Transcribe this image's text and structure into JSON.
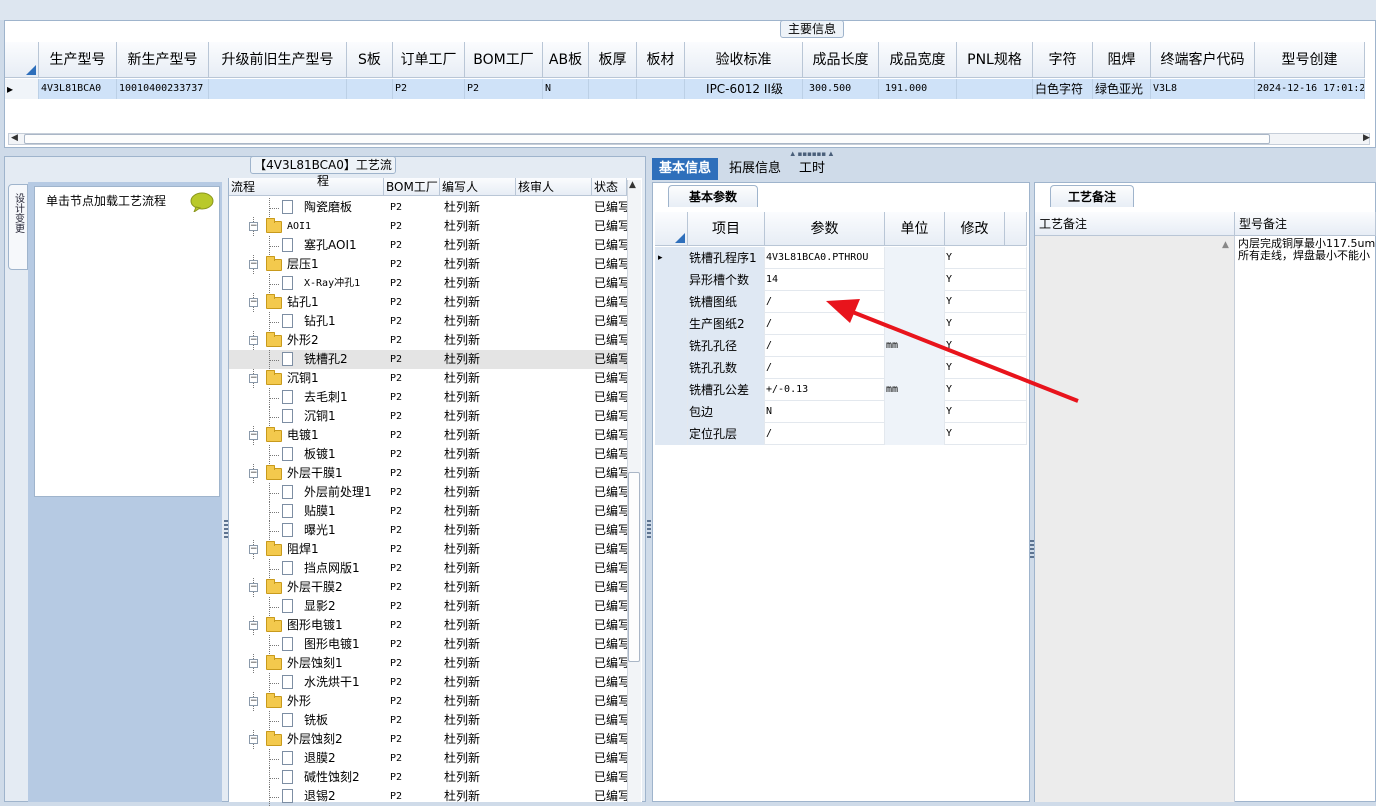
{
  "main_info": {
    "title": "主要信息",
    "columns": [
      "生产型号",
      "新生产型号",
      "升级前旧生产型号",
      "S板",
      "订单工厂",
      "BOM工厂",
      "AB板",
      "板厚",
      "板材",
      "验收标准",
      "成品长度",
      "成品宽度",
      "PNL规格",
      "字符",
      "阻焊",
      "终端客户代码",
      "型号创建"
    ],
    "row": [
      "4V3L81BCA0",
      "10010400233737",
      "",
      "",
      "P2",
      "P2",
      "N",
      "",
      "",
      "IPC-6012 II级",
      "300.500",
      "191.000",
      "",
      "白色字符",
      "绿色亚光",
      "V3L8",
      "2024-12-16 17:01:2"
    ]
  },
  "flow_panel": {
    "title": "【4V3L81BCA0】工艺流程",
    "side_tab": "设计变更",
    "nav_hint": "单击节点加载工艺流程",
    "columns": [
      "流程",
      "BOM工厂",
      "编写人",
      "核审人",
      "状态"
    ],
    "rows": [
      {
        "name": "陶瓷磨板",
        "level": 2,
        "bom": "P2",
        "writer": "杜列新",
        "status": "已编写"
      },
      {
        "name": "AOI1",
        "level": 1,
        "bom": "P2",
        "writer": "杜列新",
        "status": "已编写"
      },
      {
        "name": "塞孔AOI1",
        "level": 2,
        "bom": "P2",
        "writer": "杜列新",
        "status": "已编写"
      },
      {
        "name": "层压1",
        "level": 1,
        "bom": "P2",
        "writer": "杜列新",
        "status": "已编写"
      },
      {
        "name": "X-Ray冲孔1",
        "level": 2,
        "bom": "P2",
        "writer": "杜列新",
        "status": "已编写"
      },
      {
        "name": "钻孔1",
        "level": 1,
        "bom": "P2",
        "writer": "杜列新",
        "status": "已编写"
      },
      {
        "name": "钻孔1",
        "level": 2,
        "bom": "P2",
        "writer": "杜列新",
        "status": "已编写"
      },
      {
        "name": "外形2",
        "level": 1,
        "bom": "P2",
        "writer": "杜列新",
        "status": "已编写"
      },
      {
        "name": "铣槽孔2",
        "level": 2,
        "bom": "P2",
        "writer": "杜列新",
        "status": "已编写",
        "selected": true
      },
      {
        "name": "沉铜1",
        "level": 1,
        "bom": "P2",
        "writer": "杜列新",
        "status": "已编写"
      },
      {
        "name": "去毛刺1",
        "level": 2,
        "bom": "P2",
        "writer": "杜列新",
        "status": "已编写"
      },
      {
        "name": "沉铜1",
        "level": 2,
        "bom": "P2",
        "writer": "杜列新",
        "status": "已编写"
      },
      {
        "name": "电镀1",
        "level": 1,
        "bom": "P2",
        "writer": "杜列新",
        "status": "已编写"
      },
      {
        "name": "板镀1",
        "level": 2,
        "bom": "P2",
        "writer": "杜列新",
        "status": "已编写"
      },
      {
        "name": "外层干膜1",
        "level": 1,
        "bom": "P2",
        "writer": "杜列新",
        "status": "已编写"
      },
      {
        "name": "外层前处理1",
        "level": 2,
        "bom": "P2",
        "writer": "杜列新",
        "status": "已编写"
      },
      {
        "name": "贴膜1",
        "level": 2,
        "bom": "P2",
        "writer": "杜列新",
        "status": "已编写"
      },
      {
        "name": "曝光1",
        "level": 2,
        "bom": "P2",
        "writer": "杜列新",
        "status": "已编写"
      },
      {
        "name": "阻焊1",
        "level": 1,
        "bom": "P2",
        "writer": "杜列新",
        "status": "已编写"
      },
      {
        "name": "挡点网版1",
        "level": 2,
        "bom": "P2",
        "writer": "杜列新",
        "status": "已编写"
      },
      {
        "name": "外层干膜2",
        "level": 1,
        "bom": "P2",
        "writer": "杜列新",
        "status": "已编写"
      },
      {
        "name": "显影2",
        "level": 2,
        "bom": "P2",
        "writer": "杜列新",
        "status": "已编写"
      },
      {
        "name": "图形电镀1",
        "level": 1,
        "bom": "P2",
        "writer": "杜列新",
        "status": "已编写"
      },
      {
        "name": "图形电镀1",
        "level": 2,
        "bom": "P2",
        "writer": "杜列新",
        "status": "已编写"
      },
      {
        "name": "外层蚀刻1",
        "level": 1,
        "bom": "P2",
        "writer": "杜列新",
        "status": "已编写"
      },
      {
        "name": "水洗烘干1",
        "level": 2,
        "bom": "P2",
        "writer": "杜列新",
        "status": "已编写"
      },
      {
        "name": "外形",
        "level": 1,
        "bom": "P2",
        "writer": "杜列新",
        "status": "已编写"
      },
      {
        "name": "铣板",
        "level": 2,
        "bom": "P2",
        "writer": "杜列新",
        "status": "已编写"
      },
      {
        "name": "外层蚀刻2",
        "level": 1,
        "bom": "P2",
        "writer": "杜列新",
        "status": "已编写"
      },
      {
        "name": "退膜2",
        "level": 2,
        "bom": "P2",
        "writer": "杜列新",
        "status": "已编写"
      },
      {
        "name": "碱性蚀刻2",
        "level": 2,
        "bom": "P2",
        "writer": "杜列新",
        "status": "已编写"
      },
      {
        "name": "退锡2",
        "level": 2,
        "bom": "P2",
        "writer": "杜列新",
        "status": "已编写"
      }
    ]
  },
  "tabs": [
    "基本信息",
    "拓展信息",
    "工时"
  ],
  "params": {
    "subtab": "基本参数",
    "columns": [
      "项目",
      "参数",
      "单位",
      "修改"
    ],
    "rows": [
      {
        "item": "铣槽孔程序1",
        "param": "4V3L81BCA0.PTHROU",
        "unit": "",
        "mod": "Y"
      },
      {
        "item": "异形槽个数",
        "param": "14",
        "unit": "",
        "mod": "Y"
      },
      {
        "item": "铣槽图纸",
        "param": "/",
        "unit": "",
        "mod": "Y"
      },
      {
        "item": "生产图纸2",
        "param": "/",
        "unit": "",
        "mod": "Y"
      },
      {
        "item": "铣孔孔径",
        "param": "/",
        "unit": "mm",
        "mod": "Y"
      },
      {
        "item": "铣孔孔数",
        "param": "/",
        "unit": "",
        "mod": "Y"
      },
      {
        "item": "铣槽孔公差",
        "param": "+/-0.13",
        "unit": "mm",
        "mod": "Y"
      },
      {
        "item": "包边",
        "param": "N",
        "unit": "",
        "mod": "Y"
      },
      {
        "item": "定位孔层",
        "param": "/",
        "unit": "",
        "mod": "Y"
      }
    ]
  },
  "remarks": {
    "subtab": "工艺备注",
    "col1": "工艺备注",
    "col2": "型号备注",
    "line1": "内层完成铜厚最小117.5um",
    "line2": "所有走线，焊盘最小不能小"
  },
  "colors": {
    "accent": "#2e6fbb",
    "selected_row": "#cfe2f8",
    "arrow": "#e8141c"
  }
}
